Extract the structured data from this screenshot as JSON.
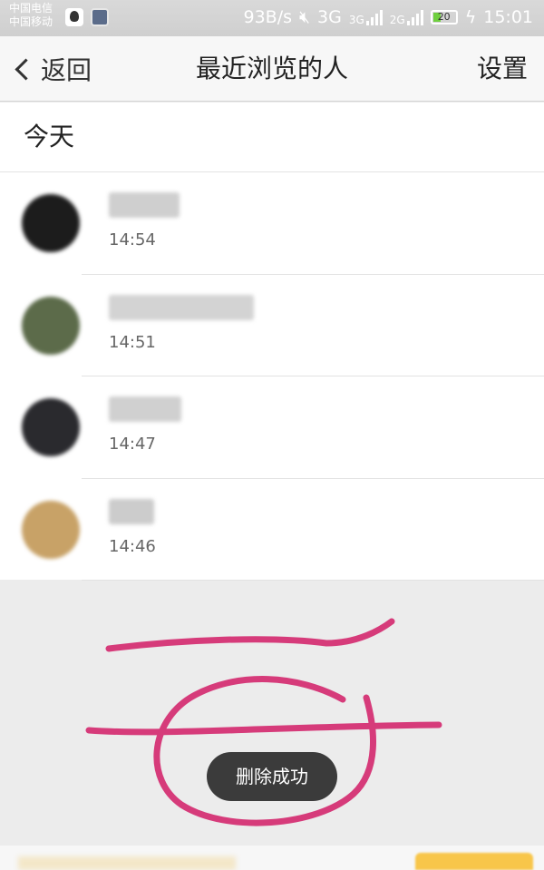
{
  "status_bar": {
    "carrier_1": "中国电信",
    "carrier_2": "中国移动",
    "speed": "93B/s",
    "net_3g": "3G",
    "net_3g_small": "3G",
    "net_2g": "2G",
    "battery": "20",
    "time": "15:01",
    "battery_color": "#6fcf3f"
  },
  "nav": {
    "back_label": "返回",
    "title": "最近浏览的人",
    "settings_label": "设置"
  },
  "list": {
    "section_title": "今天",
    "visitors": [
      {
        "time": "14:54",
        "avatar_color": "#1c1c1c",
        "name_color": "#cfcfcf"
      },
      {
        "time": "14:51",
        "avatar_color": "#5c6b4a",
        "name_color": "#d3d3d3"
      },
      {
        "time": "14:47",
        "avatar_color": "#2a2a2e",
        "name_color": "#d0d0d0"
      },
      {
        "time": "14:46",
        "avatar_color": "#c8a267",
        "name_color": "#cccccc"
      }
    ]
  },
  "toast": {
    "message": "删除成功"
  },
  "annotation": {
    "stroke_color": "#d63b7a"
  }
}
